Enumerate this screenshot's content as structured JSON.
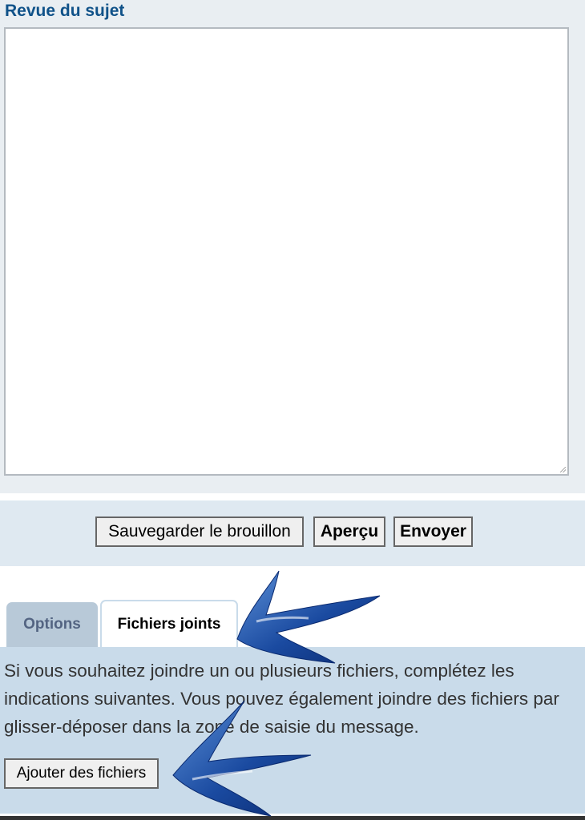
{
  "review": {
    "title": "Revue du sujet"
  },
  "submit_buttons": {
    "save_draft": "Sauvegarder le brouillon",
    "preview": "Aperçu",
    "send": "Envoyer"
  },
  "tabs": [
    {
      "label": "Options",
      "active": false
    },
    {
      "label": "Fichiers joints",
      "active": true
    }
  ],
  "attachments": {
    "instructions": "Si vous souhaitez joindre un ou plusieurs fichiers, complétez les indications suivantes. Vous pouvez également joindre des fichiers par glisser-déposer dans la zone de saisie du message.",
    "add_files_button": "Ajouter des fichiers"
  },
  "annotations": {
    "arrow_color": "#0b3a8c",
    "arrow_icon": "hand-drawn-arrow-icon"
  }
}
